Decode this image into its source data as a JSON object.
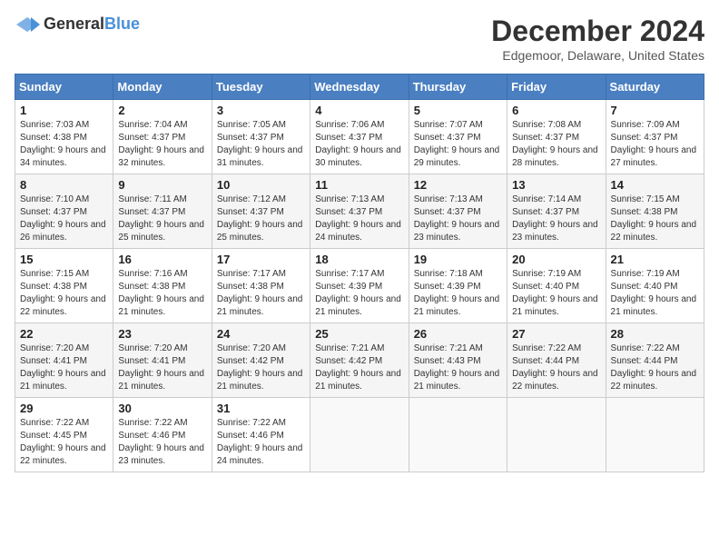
{
  "header": {
    "logo_general": "General",
    "logo_blue": "Blue",
    "title": "December 2024",
    "subtitle": "Edgemoor, Delaware, United States"
  },
  "calendar": {
    "days_of_week": [
      "Sunday",
      "Monday",
      "Tuesday",
      "Wednesday",
      "Thursday",
      "Friday",
      "Saturday"
    ],
    "weeks": [
      [
        {
          "day": "1",
          "sunrise": "7:03 AM",
          "sunset": "4:38 PM",
          "daylight": "9 hours and 34 minutes."
        },
        {
          "day": "2",
          "sunrise": "7:04 AM",
          "sunset": "4:37 PM",
          "daylight": "9 hours and 32 minutes."
        },
        {
          "day": "3",
          "sunrise": "7:05 AM",
          "sunset": "4:37 PM",
          "daylight": "9 hours and 31 minutes."
        },
        {
          "day": "4",
          "sunrise": "7:06 AM",
          "sunset": "4:37 PM",
          "daylight": "9 hours and 30 minutes."
        },
        {
          "day": "5",
          "sunrise": "7:07 AM",
          "sunset": "4:37 PM",
          "daylight": "9 hours and 29 minutes."
        },
        {
          "day": "6",
          "sunrise": "7:08 AM",
          "sunset": "4:37 PM",
          "daylight": "9 hours and 28 minutes."
        },
        {
          "day": "7",
          "sunrise": "7:09 AM",
          "sunset": "4:37 PM",
          "daylight": "9 hours and 27 minutes."
        }
      ],
      [
        {
          "day": "8",
          "sunrise": "7:10 AM",
          "sunset": "4:37 PM",
          "daylight": "9 hours and 26 minutes."
        },
        {
          "day": "9",
          "sunrise": "7:11 AM",
          "sunset": "4:37 PM",
          "daylight": "9 hours and 25 minutes."
        },
        {
          "day": "10",
          "sunrise": "7:12 AM",
          "sunset": "4:37 PM",
          "daylight": "9 hours and 25 minutes."
        },
        {
          "day": "11",
          "sunrise": "7:13 AM",
          "sunset": "4:37 PM",
          "daylight": "9 hours and 24 minutes."
        },
        {
          "day": "12",
          "sunrise": "7:13 AM",
          "sunset": "4:37 PM",
          "daylight": "9 hours and 23 minutes."
        },
        {
          "day": "13",
          "sunrise": "7:14 AM",
          "sunset": "4:37 PM",
          "daylight": "9 hours and 23 minutes."
        },
        {
          "day": "14",
          "sunrise": "7:15 AM",
          "sunset": "4:38 PM",
          "daylight": "9 hours and 22 minutes."
        }
      ],
      [
        {
          "day": "15",
          "sunrise": "7:15 AM",
          "sunset": "4:38 PM",
          "daylight": "9 hours and 22 minutes."
        },
        {
          "day": "16",
          "sunrise": "7:16 AM",
          "sunset": "4:38 PM",
          "daylight": "9 hours and 21 minutes."
        },
        {
          "day": "17",
          "sunrise": "7:17 AM",
          "sunset": "4:38 PM",
          "daylight": "9 hours and 21 minutes."
        },
        {
          "day": "18",
          "sunrise": "7:17 AM",
          "sunset": "4:39 PM",
          "daylight": "9 hours and 21 minutes."
        },
        {
          "day": "19",
          "sunrise": "7:18 AM",
          "sunset": "4:39 PM",
          "daylight": "9 hours and 21 minutes."
        },
        {
          "day": "20",
          "sunrise": "7:19 AM",
          "sunset": "4:40 PM",
          "daylight": "9 hours and 21 minutes."
        },
        {
          "day": "21",
          "sunrise": "7:19 AM",
          "sunset": "4:40 PM",
          "daylight": "9 hours and 21 minutes."
        }
      ],
      [
        {
          "day": "22",
          "sunrise": "7:20 AM",
          "sunset": "4:41 PM",
          "daylight": "9 hours and 21 minutes."
        },
        {
          "day": "23",
          "sunrise": "7:20 AM",
          "sunset": "4:41 PM",
          "daylight": "9 hours and 21 minutes."
        },
        {
          "day": "24",
          "sunrise": "7:20 AM",
          "sunset": "4:42 PM",
          "daylight": "9 hours and 21 minutes."
        },
        {
          "day": "25",
          "sunrise": "7:21 AM",
          "sunset": "4:42 PM",
          "daylight": "9 hours and 21 minutes."
        },
        {
          "day": "26",
          "sunrise": "7:21 AM",
          "sunset": "4:43 PM",
          "daylight": "9 hours and 21 minutes."
        },
        {
          "day": "27",
          "sunrise": "7:22 AM",
          "sunset": "4:44 PM",
          "daylight": "9 hours and 22 minutes."
        },
        {
          "day": "28",
          "sunrise": "7:22 AM",
          "sunset": "4:44 PM",
          "daylight": "9 hours and 22 minutes."
        }
      ],
      [
        {
          "day": "29",
          "sunrise": "7:22 AM",
          "sunset": "4:45 PM",
          "daylight": "9 hours and 22 minutes."
        },
        {
          "day": "30",
          "sunrise": "7:22 AM",
          "sunset": "4:46 PM",
          "daylight": "9 hours and 23 minutes."
        },
        {
          "day": "31",
          "sunrise": "7:22 AM",
          "sunset": "4:46 PM",
          "daylight": "9 hours and 24 minutes."
        },
        null,
        null,
        null,
        null
      ]
    ]
  }
}
